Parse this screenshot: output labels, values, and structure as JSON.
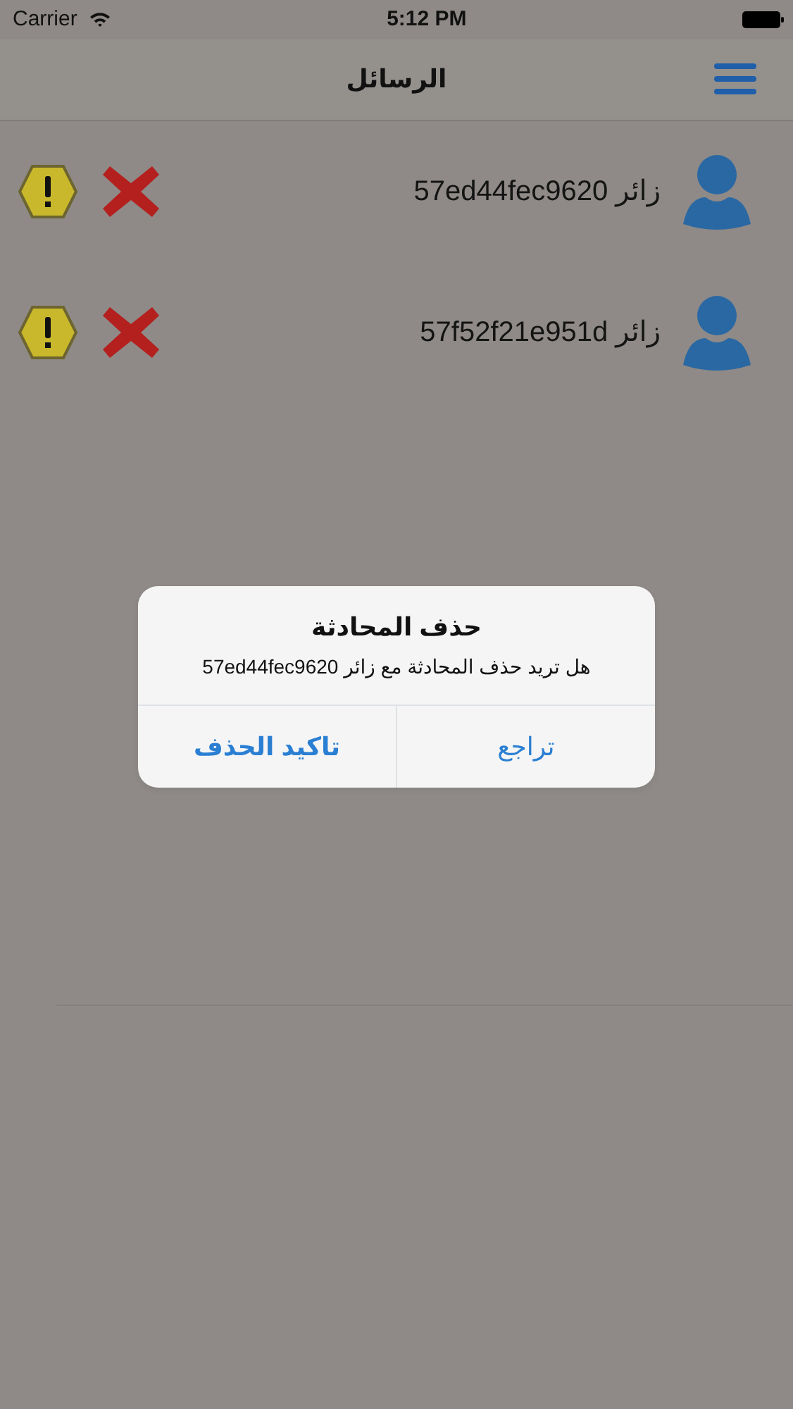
{
  "status_bar": {
    "carrier": "Carrier",
    "time": "5:12 PM"
  },
  "nav_bar": {
    "title": "الرسائل"
  },
  "conversations": [
    {
      "label": "زائر 57ed44fec9620"
    },
    {
      "label": "زائر 57f52f21e951d"
    }
  ],
  "alert": {
    "title": "حذف المحادثة",
    "message": "هل تريد حذف المحادثة مع زائر 57ed44fec9620",
    "buttons": [
      {
        "label": "تراجع",
        "preferred": false
      },
      {
        "label": "تاكيد الحذف",
        "preferred": true
      }
    ]
  }
}
